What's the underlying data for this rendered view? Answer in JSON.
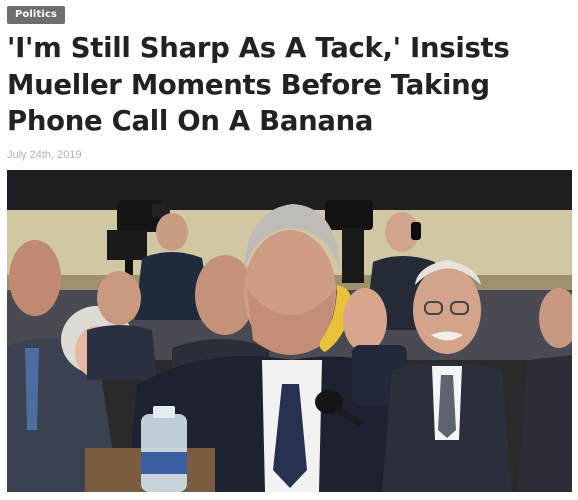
{
  "article": {
    "category": "Politics",
    "headline": "'I'm Still Sharp As A Tack,' Insists Mueller Moments Before Taking Phone Call On A Banana",
    "date": "July 24th, 2019"
  },
  "colors": {
    "category_bg": "#6e6e6e",
    "headline_text": "#222222",
    "date_text": "#b3b3b3"
  },
  "image": {
    "subject": "news-photo"
  }
}
